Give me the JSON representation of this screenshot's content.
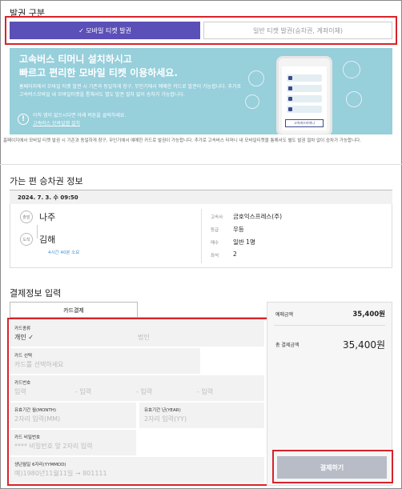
{
  "issue": {
    "section_title": "발권 구분",
    "tab_mobile": "✓ 모바일 티켓 발권",
    "tab_paper": "일반 티켓 발권(승차권, 계좌이체)"
  },
  "banner": {
    "headline_line1": "고속버스 티머니 설치하시고",
    "headline_line2": "빠르고 편리한 모바일 티켓 이용하세요.",
    "desc": "홈페이지에서 모바일 티켓 발권 시 기존과 동일하게 창구, 무인기에서 예매한 카드로 발권이 가능합니다. 추가로 고속버스모바일 내 모바일티켓을 통해서도 별도 발권 절차 없이 승차가 가능합니다.",
    "note_line1": "아직 앱이 없으시다면 아래 버튼을 클릭하세요.",
    "note_link": "고속버스 모바일앱 설치",
    "phone_brand": "고속버스티머니"
  },
  "footnote": "홈페이지에서 모바일 티켓 발권 시 기존과 동일하게 창구, 무인기에서 예매한 카드로 발권이 가능합니다. 추가로 고속버스 티머니 내 모바일티켓을 통해서도 별도 발권 절차 없이 승차가 가능합니다.",
  "trip": {
    "section_title": "가는 편 승차권 정보",
    "datetime": "2024. 7. 3. 수 09:50",
    "depart_badge": "출발",
    "depart_name": "나주",
    "arrive_badge": "도착",
    "arrive_name": "김해",
    "duration": "4시간 40분 소요",
    "company_label": "고속사",
    "company": "금호익스프레스(주)",
    "grade_label": "등급",
    "grade": "우등",
    "count_label": "매수",
    "count": "일반 1명",
    "seat_label": "좌석",
    "seat": "2"
  },
  "payment": {
    "section_title": "결제정보 입력",
    "tab_card": "카드결제",
    "card_type_label": "카드종류",
    "card_type_personal": "개인 ✓",
    "card_type_corporate": "법인",
    "card_select_label": "카드 선택",
    "card_select_placeholder": "카드를 선택하세요",
    "card_number_label": "카드번호",
    "card_number_p1": "입력",
    "card_number_p2": "- 입력",
    "card_number_p3": "- 입력",
    "card_number_p4": "- 입력",
    "exp_month_label": "유효기간 월(MONTH)",
    "exp_month_placeholder": "2자리 입력(MM)",
    "exp_year_label": "유효기간 년(YEAR)",
    "exp_year_placeholder": "2자리 입력(YY)",
    "pw_label": "카드 비밀번호",
    "pw_placeholder": "**** 비밀번호 앞 2자리 입력",
    "birth_label": "생년월일 6자리(YYMMDD)",
    "birth_placeholder": "예)1980년11월11일 → 801111"
  },
  "summary": {
    "fare_label": "예매금액",
    "fare": "35,400원",
    "total_label": "총 결제금액",
    "total": "35,400원",
    "pay_button": "결제하기"
  },
  "colors": {
    "accent": "#5b4fb8",
    "banner": "#97cfdb",
    "highlight": "#d9232a",
    "pay_button": "#b8bcc7"
  }
}
